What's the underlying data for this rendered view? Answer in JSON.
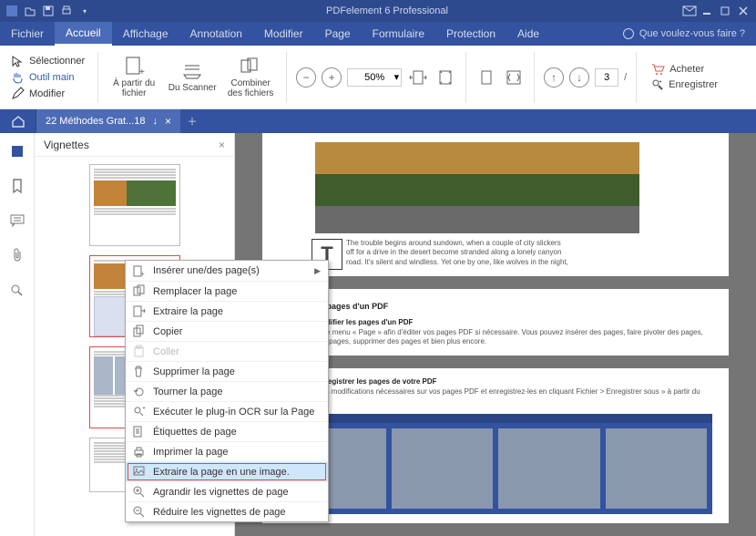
{
  "titlebar": {
    "title": "PDFelement 6 Professional"
  },
  "menubar": {
    "items": [
      "Fichier",
      "Accueil",
      "Affichage",
      "Annotation",
      "Modifier",
      "Page",
      "Formulaire",
      "Protection",
      "Aide"
    ],
    "help_placeholder": "Que voulez-vous faire ?"
  },
  "ribbon": {
    "select": "Sélectionner",
    "hand": "Outil main",
    "edit": "Modifier",
    "from_label": "À partir du fichier",
    "scanner_label": "Du Scanner",
    "combine_label": "Combiner des fichiers",
    "zoom": "50%",
    "page_no": "3",
    "page_sep": "/",
    "buy": "Acheter",
    "register": "Enregistrer"
  },
  "tabstrip": {
    "doc_title": "22 Méthodes Grat...18",
    "doc_badge": "↓"
  },
  "thumb_panel": {
    "title": "Vignettes"
  },
  "context_menu": {
    "items": [
      {
        "label": "Insérer une/des page(s)",
        "submenu": true
      },
      {
        "label": "Remplacer la page"
      },
      {
        "label": "Extraire la page"
      },
      {
        "label": "Copier"
      },
      {
        "label": "Coller",
        "disabled": true
      },
      {
        "label": "Supprimer la page"
      },
      {
        "label": "Tourner la page"
      },
      {
        "label": "Exécuter le plug-in OCR sur la Page"
      },
      {
        "label": "Étiquettes de page"
      },
      {
        "label": "Imprimer la page"
      },
      {
        "label": "Extraire la page en une image.",
        "highlight": true
      },
      {
        "label": "Agrandir les vignettes de page"
      },
      {
        "label": "Réduire les vignettes de page"
      }
    ]
  },
  "doc": {
    "p1_caption_a": "The trouble begins around sundown, when a couple of city slickers",
    "p1_caption_b": "off for a drive in the desert become stranded along a lonely canyon",
    "p1_caption_c": "road. It's silent and windless. Yet one by one, like wolves in the night,",
    "h1": "Modifier les pages d'un PDF",
    "step1": "Étape 1 : Modifier les pages d'un PDF",
    "step1_txt": "Cliquez sur le menu « Page » afin d'éditer vos pages PDF si nécessaire. Vous pouvez insérer des pages, faire pivoter des pages, recadrer des pages, supprimer des pages et bien plus encore.",
    "step2": "Étape 2 : Enregistrer les pages de votre PDF",
    "step2_txt": "Appliquez les modifications nécessaires sur vos pages PDF et enregistrez-les en cliquant Fichier > Enregistrer sous » à partir du sous-menu."
  }
}
